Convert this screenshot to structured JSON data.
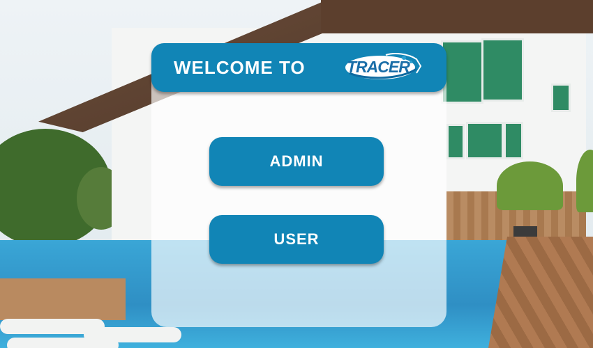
{
  "header": {
    "title": "WELCOME TO",
    "logo_text": "TRACER"
  },
  "buttons": {
    "admin_label": "ADMIN",
    "user_label": "USER"
  },
  "colors": {
    "accent": "#1185b6",
    "button_text": "#ffffff",
    "logo_text": "#1a6ea8"
  },
  "icons": {
    "logo": "tracer-logo"
  }
}
